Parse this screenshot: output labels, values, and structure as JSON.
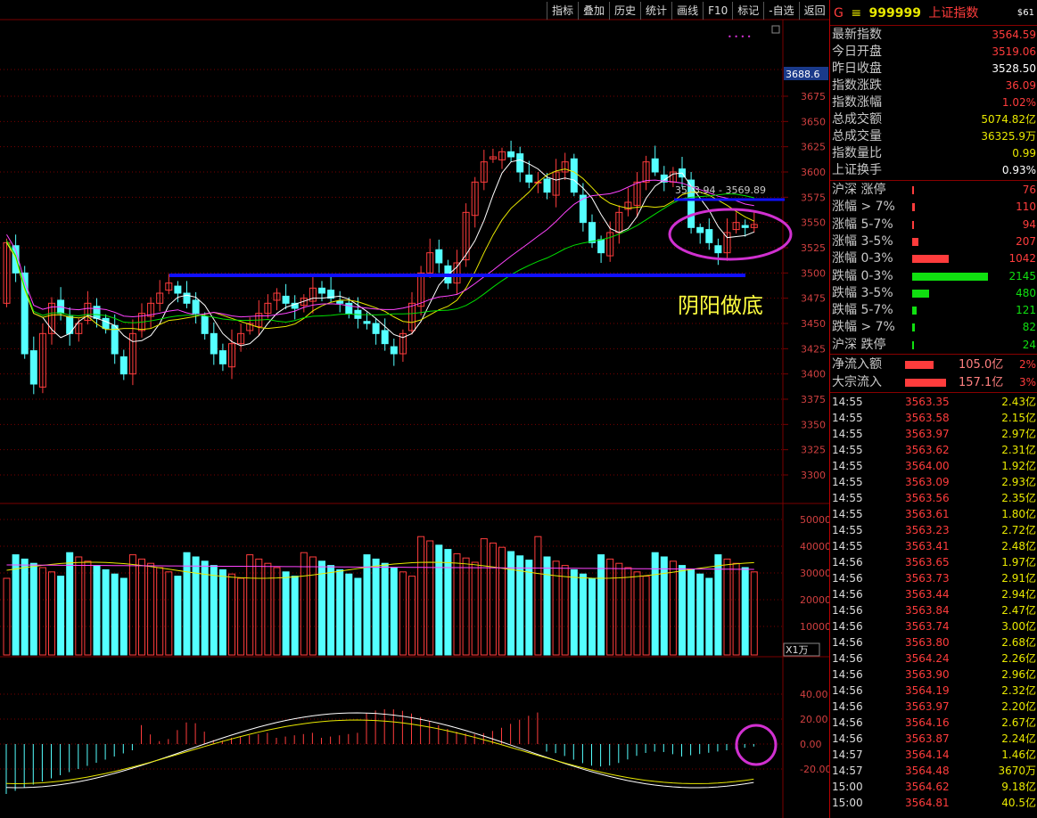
{
  "toolbar": {
    "items": [
      "指标",
      "叠加",
      "历史",
      "统计",
      "画线",
      "F10",
      "标记",
      "-自选",
      "返回"
    ]
  },
  "header": {
    "code_letter": "G",
    "menu_glyph": "≡",
    "code": "999999",
    "name": "上证指数",
    "badge": "$61"
  },
  "colors": {
    "up": "#ff3c3c",
    "down": "#54ffff",
    "ma5": "#ffffff",
    "ma10": "#e8e800",
    "ma20": "#ff44ff",
    "ma60": "#00e000",
    "line": "#1010ff",
    "grid": "#7a0000",
    "circle": "#d030d0",
    "annot": "#ffff40"
  },
  "price_axis": {
    "current_label": "3688.6",
    "ticks": [
      "3675",
      "3650",
      "3625",
      "3600",
      "3575",
      "3550",
      "3525",
      "3500",
      "3475",
      "3450",
      "3425",
      "3400",
      "3375",
      "3350",
      "3325",
      "3300"
    ]
  },
  "volume_axis": {
    "ticks": [
      "50000",
      "40000",
      "30000",
      "20000",
      "10000"
    ],
    "unit": "X1万"
  },
  "macd_axis": {
    "ticks": [
      "40.00",
      "20.00",
      "0.00",
      "-20.00"
    ]
  },
  "annotations": {
    "range_label": "3573.94 - 3569.89",
    "text": "阴阳做底"
  },
  "quote": [
    {
      "label": "最新指数",
      "value": "3564.59",
      "color": "#ff3c3c"
    },
    {
      "label": "今日开盘",
      "value": "3519.06",
      "color": "#ff3c3c"
    },
    {
      "label": "昨日收盘",
      "value": "3528.50",
      "color": "#ffffff"
    },
    {
      "label": "指数涨跌",
      "value": "36.09",
      "color": "#ff3c3c"
    },
    {
      "label": "指数涨幅",
      "value": "1.02%",
      "color": "#ff3c3c"
    },
    {
      "label": "总成交额",
      "value": "5074.82亿",
      "color": "#e8e800"
    },
    {
      "label": "总成交量",
      "value": "36325.9万",
      "color": "#e8e800"
    },
    {
      "label": "指数量比",
      "value": "0.99",
      "color": "#e8e800"
    },
    {
      "label": "上证换手",
      "value": "0.93%",
      "color": "#ffffff"
    }
  ],
  "breadth": [
    {
      "label": "沪深 涨停",
      "value": "76",
      "frac": 0.02,
      "up": true
    },
    {
      "label": "涨幅 > 7%",
      "value": "110",
      "frac": 0.03,
      "up": true
    },
    {
      "label": "涨幅 5-7%",
      "value": "94",
      "frac": 0.025,
      "up": true
    },
    {
      "label": "涨幅 3-5%",
      "value": "207",
      "frac": 0.08,
      "up": true
    },
    {
      "label": "涨幅 0-3%",
      "value": "1042",
      "frac": 0.48,
      "up": true
    },
    {
      "label": "跌幅 0-3%",
      "value": "2145",
      "frac": 1.0,
      "up": false
    },
    {
      "label": "跌幅 3-5%",
      "value": "480",
      "frac": 0.22,
      "up": false
    },
    {
      "label": "跌幅 5-7%",
      "value": "121",
      "frac": 0.055,
      "up": false
    },
    {
      "label": "跌幅 > 7%",
      "value": "82",
      "frac": 0.04,
      "up": false
    },
    {
      "label": "沪深 跌停",
      "value": "24",
      "frac": 0.012,
      "up": false
    }
  ],
  "flows": [
    {
      "label": "净流入额",
      "amount": "105.0亿",
      "pct": "2%"
    },
    {
      "label": "大宗流入",
      "amount": "157.1亿",
      "pct": "3%"
    }
  ],
  "ticks_list": [
    {
      "time": "14:55",
      "price": "3563.35",
      "vol": "2.43亿"
    },
    {
      "time": "14:55",
      "price": "3563.58",
      "vol": "2.15亿"
    },
    {
      "time": "14:55",
      "price": "3563.97",
      "vol": "2.97亿"
    },
    {
      "time": "14:55",
      "price": "3563.62",
      "vol": "2.31亿"
    },
    {
      "time": "14:55",
      "price": "3564.00",
      "vol": "1.92亿"
    },
    {
      "time": "14:55",
      "price": "3563.09",
      "vol": "2.93亿"
    },
    {
      "time": "14:55",
      "price": "3563.56",
      "vol": "2.35亿"
    },
    {
      "time": "14:55",
      "price": "3563.61",
      "vol": "1.80亿"
    },
    {
      "time": "14:55",
      "price": "3563.23",
      "vol": "2.72亿"
    },
    {
      "time": "14:55",
      "price": "3563.41",
      "vol": "2.48亿"
    },
    {
      "time": "14:56",
      "price": "3563.65",
      "vol": "1.97亿"
    },
    {
      "time": "14:56",
      "price": "3563.73",
      "vol": "2.91亿"
    },
    {
      "time": "14:56",
      "price": "3563.44",
      "vol": "2.94亿"
    },
    {
      "time": "14:56",
      "price": "3563.84",
      "vol": "2.47亿"
    },
    {
      "time": "14:56",
      "price": "3563.74",
      "vol": "3.00亿"
    },
    {
      "time": "14:56",
      "price": "3563.80",
      "vol": "2.68亿"
    },
    {
      "time": "14:56",
      "price": "3564.24",
      "vol": "2.26亿"
    },
    {
      "time": "14:56",
      "price": "3563.90",
      "vol": "2.96亿"
    },
    {
      "time": "14:56",
      "price": "3564.19",
      "vol": "2.32亿"
    },
    {
      "time": "14:56",
      "price": "3563.97",
      "vol": "2.20亿"
    },
    {
      "time": "14:56",
      "price": "3564.16",
      "vol": "2.67亿"
    },
    {
      "time": "14:56",
      "price": "3563.87",
      "vol": "2.24亿"
    },
    {
      "time": "14:57",
      "price": "3564.14",
      "vol": "1.46亿"
    },
    {
      "time": "14:57",
      "price": "3564.48",
      "vol": "3670万"
    },
    {
      "time": "15:00",
      "price": "3564.62",
      "vol": "9.18亿"
    },
    {
      "time": "15:00",
      "price": "3564.81",
      "vol": "40.5亿"
    }
  ]
}
